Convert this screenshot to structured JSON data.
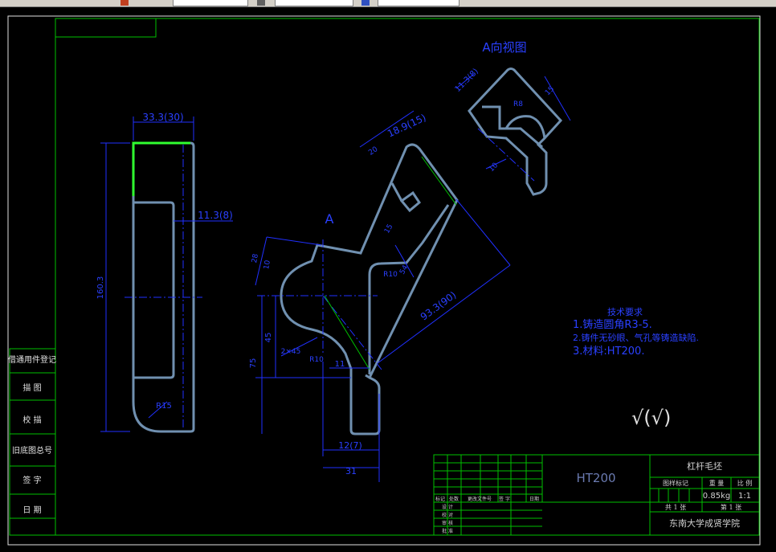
{
  "view_labels": {
    "section_a": "A",
    "a_view_title": "A向视图"
  },
  "dims": {
    "left_width": "33.3(30)",
    "left_height": "160.3",
    "left_slot": "11.3(8)",
    "left_radius": "R15",
    "main_top1": "18.9(15)",
    "main_top2": "20",
    "main_top3": "15",
    "main_28": "28",
    "main_10": "10",
    "main_r10": "R10",
    "main_54": "54",
    "main_long": "93.3(90)",
    "main_45": "45",
    "main_75": "75",
    "main_chamfer": "2×45",
    "main_r10b": "R10",
    "main_11": "11",
    "main_12": "12(7)",
    "main_31": "31",
    "a_view_1": "11.3(8)",
    "a_view_2": "15",
    "a_view_r": "R8",
    "a_view_3": "10"
  },
  "tech_notes": {
    "title": "技术要求",
    "lines": [
      "1.铸造圆角R3-5.",
      "2.铸件无砂眼、气孔等铸造缺陷.",
      "3.材料:HT200."
    ]
  },
  "roughness_symbol": "√(√)",
  "left_column": [
    "借通用件登记",
    "描 图",
    "校 描",
    "旧底图总号",
    "签 字",
    "日 期"
  ],
  "title_block": {
    "material": "HT200",
    "part_name": "杠杆毛坯",
    "weight": "0.85kg",
    "scale": "1:1",
    "school": "东南大学成贤学院",
    "header_labels": [
      "图样标记",
      "重 量",
      "比 例"
    ],
    "sheets": [
      "共 1 张",
      "第 1 张"
    ],
    "change_labels": [
      "标记",
      "处数",
      "更改文件号",
      "签 字",
      "日期"
    ],
    "sign_rows": [
      "设 计",
      "校 对",
      "审 核",
      "批 准"
    ]
  }
}
